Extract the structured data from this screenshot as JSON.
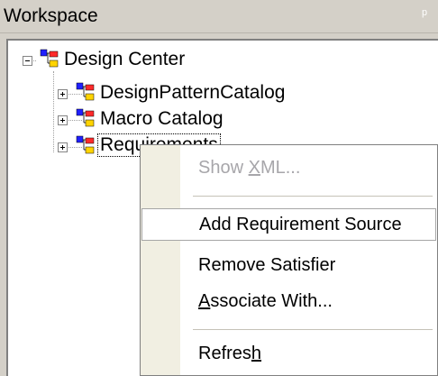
{
  "window": {
    "title": "Workspace",
    "pin_glyph": "ᵖ"
  },
  "tree": {
    "root": {
      "label": "Design Center",
      "icon": "design-center-icon",
      "expanded": true
    },
    "children": [
      {
        "label": "DesignPatternCatalog",
        "icon": "catalog-icon",
        "expanded": false
      },
      {
        "label": "Macro Catalog",
        "icon": "catalog-icon",
        "expanded": false
      },
      {
        "label": "Requirements",
        "icon": "catalog-icon",
        "expanded": false,
        "selected": true
      }
    ]
  },
  "context_menu": {
    "items": [
      {
        "pre": "Show ",
        "mnemonic": "X",
        "post": "ML...",
        "enabled": false
      },
      {
        "pre": "Add Requirement Source",
        "mnemonic": "",
        "post": "",
        "enabled": true,
        "highlighted": true
      },
      {
        "pre": "Remove Satisfier",
        "mnemonic": "",
        "post": "",
        "enabled": true
      },
      {
        "pre": "",
        "mnemonic": "A",
        "post": "ssociate With...",
        "enabled": true
      },
      {
        "pre": "Refres",
        "mnemonic": "h",
        "post": "",
        "enabled": true
      }
    ]
  },
  "colors": {
    "panel_bg": "#d4d0c8",
    "disabled_text": "#a7a6aa",
    "menu_gutter": "#f1efe2"
  }
}
